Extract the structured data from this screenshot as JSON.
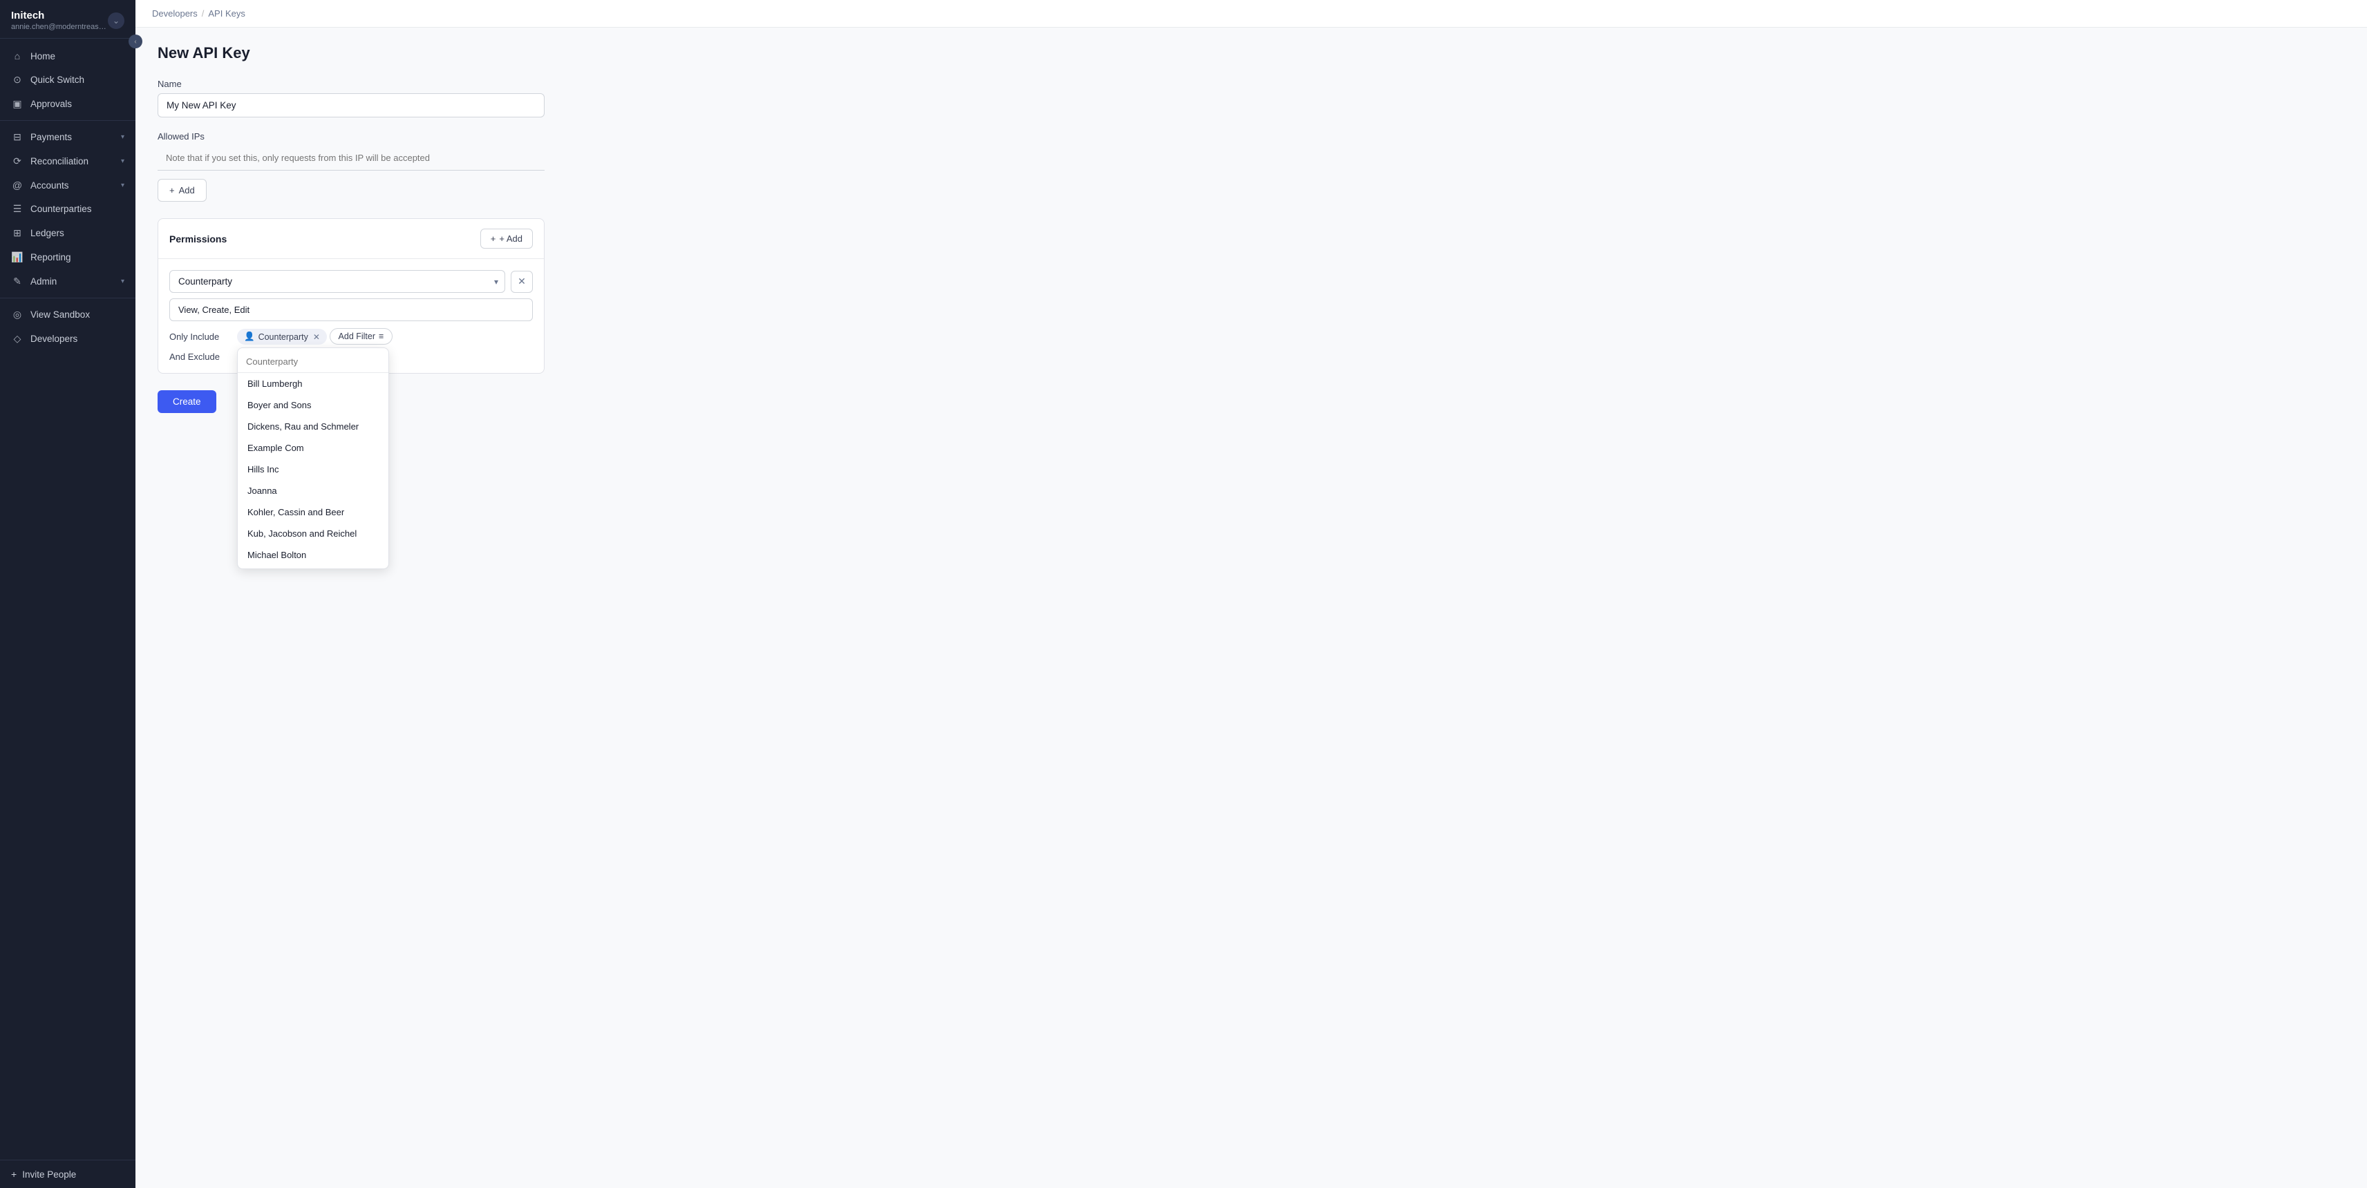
{
  "sidebar": {
    "org_name": "Initech",
    "org_email": "annie.chen@moderntreasur...",
    "collapse_icon": "‹",
    "nav_items": [
      {
        "id": "home",
        "label": "Home",
        "icon": "⌂",
        "has_arrow": false
      },
      {
        "id": "quick-switch",
        "label": "Quick Switch",
        "icon": "⊙",
        "has_arrow": false
      },
      {
        "id": "approvals",
        "label": "Approvals",
        "icon": "▣",
        "has_arrow": false
      },
      {
        "id": "payments",
        "label": "Payments",
        "icon": "⊟",
        "has_arrow": true
      },
      {
        "id": "reconciliation",
        "label": "Reconciliation",
        "icon": "⟳",
        "has_arrow": true
      },
      {
        "id": "accounts",
        "label": "Accounts",
        "icon": "@",
        "has_arrow": true
      },
      {
        "id": "counterparties",
        "label": "Counterparties",
        "icon": "☰",
        "has_arrow": false
      },
      {
        "id": "ledgers",
        "label": "Ledgers",
        "icon": "⊞",
        "has_arrow": false
      },
      {
        "id": "reporting",
        "label": "Reporting",
        "icon": "📊",
        "has_arrow": false
      },
      {
        "id": "admin",
        "label": "Admin",
        "icon": "✎",
        "has_arrow": true
      },
      {
        "id": "view-sandbox",
        "label": "View Sandbox",
        "icon": "◎",
        "has_arrow": false
      },
      {
        "id": "developers",
        "label": "Developers",
        "icon": "◇",
        "has_arrow": false
      }
    ],
    "footer": {
      "label": "Invite People",
      "icon": "+"
    }
  },
  "breadcrumb": {
    "parent": "Developers",
    "separator": "/",
    "current": "API Keys"
  },
  "page": {
    "title": "New API Key"
  },
  "form": {
    "name_label": "Name",
    "name_value": "My New API Key",
    "allowed_ips_label": "Allowed IPs",
    "allowed_ips_placeholder": "Note that if you set this, only requests from this IP will be accepted",
    "add_button": "+ Add"
  },
  "permissions": {
    "title": "Permissions",
    "add_button": "+ Add",
    "resource_value": "Counterparty",
    "actions_value": "View, Create, Edit",
    "only_include_label": "Only Include",
    "and_exclude_label": "And Exclude",
    "filter_tag": "Counterparty",
    "add_filter_button": "Add Filter",
    "filter_icon": "≡"
  },
  "dropdown": {
    "search_placeholder": "Counterparty",
    "items": [
      "Bill Lumbergh",
      "Boyer and Sons",
      "Dickens, Rau and Schmeler",
      "Example Com",
      "Hills Inc",
      "Joanna",
      "Kohler, Cassin and Beer",
      "Kub, Jacobson and Reichel",
      "Michael Bolton"
    ]
  },
  "create_button": "Create"
}
